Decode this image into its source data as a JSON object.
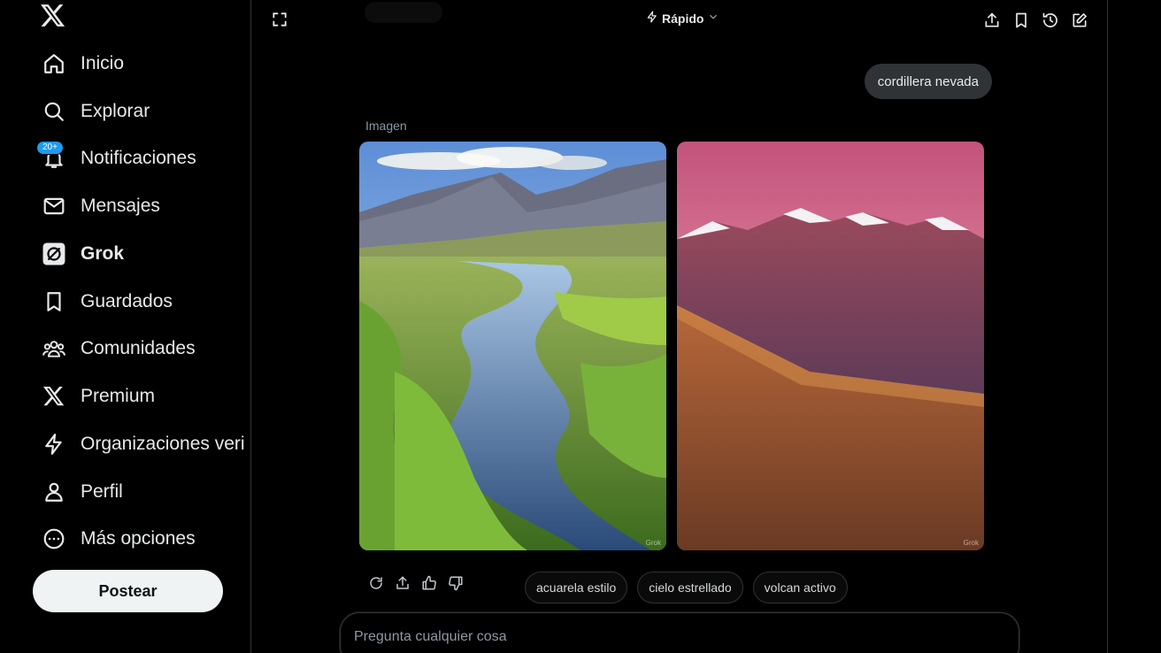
{
  "sidebar": {
    "items": [
      {
        "label": "Inicio",
        "icon": "home-icon"
      },
      {
        "label": "Explorar",
        "icon": "search-icon"
      },
      {
        "label": "Notificaciones",
        "icon": "bell-icon",
        "badge": "20+"
      },
      {
        "label": "Mensajes",
        "icon": "mail-icon"
      },
      {
        "label": "Grok",
        "icon": "grok-icon",
        "active": true
      },
      {
        "label": "Guardados",
        "icon": "bookmark-icon"
      },
      {
        "label": "Comunidades",
        "icon": "communities-icon"
      },
      {
        "label": "Premium",
        "icon": "x-logo-icon"
      },
      {
        "label": "Organizaciones verificadas",
        "icon": "lightning-icon"
      },
      {
        "label": "Perfil",
        "icon": "person-icon"
      },
      {
        "label": "Más opciones",
        "icon": "more-circle-icon"
      }
    ],
    "post_label": "Postear"
  },
  "header": {
    "mode_label": "Rápido"
  },
  "conversation": {
    "user_message": "cordillera nevada",
    "response_label": "Imagen",
    "watermark": "Grok"
  },
  "suggestions": [
    "acuarela estilo",
    "cielo estrellado",
    "volcan activo"
  ],
  "composer": {
    "placeholder": "Pregunta cualquier cosa"
  },
  "colors": {
    "background": "#000000",
    "accent": "#1d9bf0",
    "bubble": "#2f3336"
  }
}
